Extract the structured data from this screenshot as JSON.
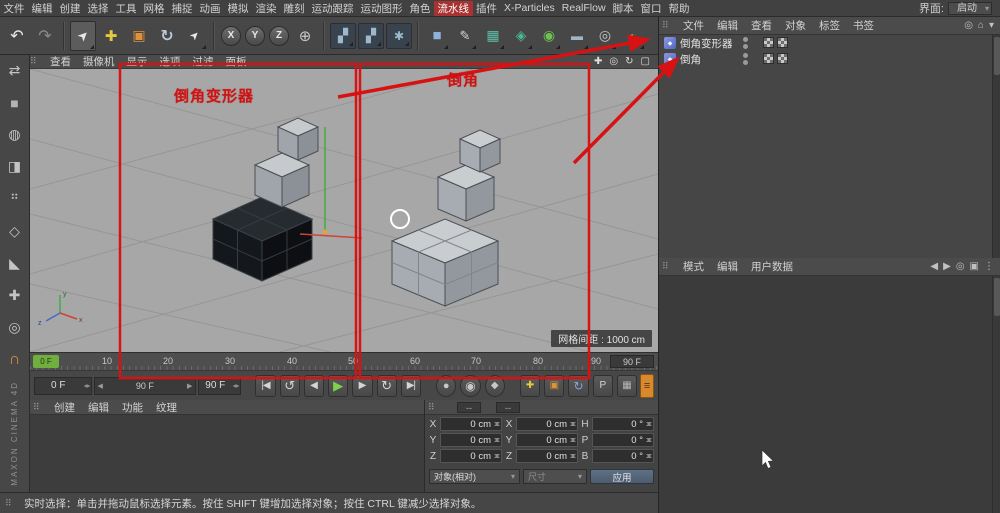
{
  "menubar": {
    "items": [
      "文件",
      "编辑",
      "创建",
      "选择",
      "工具",
      "网格",
      "捕捉",
      "动画",
      "模拟",
      "渲染",
      "雕刻",
      "运动跟踪",
      "运动图形",
      "角色",
      "流水线",
      "插件",
      "X-Particles",
      "RealFlow",
      "脚本",
      "窗口",
      "帮助"
    ],
    "interface_label": "界面:",
    "interface_value": "启动"
  },
  "toolbar": {
    "axis_x": "X",
    "axis_y": "Y",
    "axis_z": "Z",
    "icons": [
      "undo",
      "redo",
      "live-selection",
      "move",
      "scale",
      "rotate",
      "last-tool",
      "lock-x",
      "lock-y",
      "lock-z",
      "coordinate-system",
      "render-view",
      "render-to-picture-viewer",
      "render-settings",
      "add-cube",
      "pen-spline",
      "subdivision-surface",
      "mograph",
      "simulation",
      "floor",
      "camera",
      "environment"
    ]
  },
  "left_toolbar": {
    "icons": [
      "make-editable",
      "model-mode",
      "texture-mode",
      "workplane-mode",
      "points-mode",
      "edges-mode",
      "polygons-mode",
      "enable-axis",
      "viewport-solo",
      "snapping"
    ],
    "logo": "MAXON CINEMA 4D"
  },
  "viewport": {
    "menus": [
      "查看",
      "摄像机",
      "显示",
      "选项",
      "过滤",
      "面板"
    ],
    "nav_icons": [
      "move-view",
      "zoom-view",
      "rotate-view",
      "toggle-view"
    ],
    "grid_label": "网格间距 : 1000 cm",
    "axis_labels": {
      "x": "x",
      "y": "y",
      "z": "z"
    }
  },
  "annotations": {
    "left_label": "倒角变形器",
    "right_label": "倒角"
  },
  "object_manager": {
    "menus": [
      "文件",
      "编辑",
      "查看",
      "对象",
      "标签",
      "书签"
    ],
    "objects": [
      "倒角变形器",
      "倒角"
    ]
  },
  "attribute_manager": {
    "menus": [
      "模式",
      "编辑",
      "用户数据"
    ]
  },
  "timeline": {
    "marker_label": "0 F",
    "ticks": [
      "10",
      "20",
      "30",
      "40",
      "50",
      "60",
      "70",
      "80",
      "90"
    ],
    "end_field": "90 F"
  },
  "transport": {
    "current": "0 F",
    "slider_end": "90 F",
    "end": "90 F",
    "param_label": "P",
    "buttons": [
      "go-to-start",
      "previous-key",
      "previous-frame",
      "play",
      "next-frame",
      "next-key",
      "go-to-end",
      "record-keyframe",
      "autokey",
      "keyframe-selection",
      "record-position",
      "record-scale",
      "record-rotation",
      "record-parameter",
      "record-pla",
      "timeline-menu"
    ]
  },
  "materials_panel": {
    "menus": [
      "创建",
      "编辑",
      "功能",
      "纹理"
    ]
  },
  "coordinates": {
    "header_left": "--",
    "header_right": "--",
    "rows": [
      {
        "l1": "X",
        "v1": "0 cm",
        "l2": "X",
        "v2": "0 cm",
        "l3": "H",
        "v3": "0 °"
      },
      {
        "l1": "Y",
        "v1": "0 cm",
        "l2": "Y",
        "v2": "0 cm",
        "l3": "P",
        "v3": "0 °"
      },
      {
        "l1": "Z",
        "v1": "0 cm",
        "l2": "Z",
        "v2": "0 cm",
        "l3": "B",
        "v3": "0 °"
      }
    ],
    "dropdown_left": "对象(相对)",
    "dropdown_mid": "尺寸",
    "apply": "应用"
  },
  "status_bar": {
    "text": "实时选择：单击并拖动鼠标选择元素。按住 SHIFT 键增加选择对象；按住 CTRL 键减少选择对象。"
  },
  "colors": {
    "annotation_red": "#d41111",
    "play_green": "#7fd34a",
    "marker_green": "#6fae3f",
    "snap_orange": "#e0923a"
  }
}
